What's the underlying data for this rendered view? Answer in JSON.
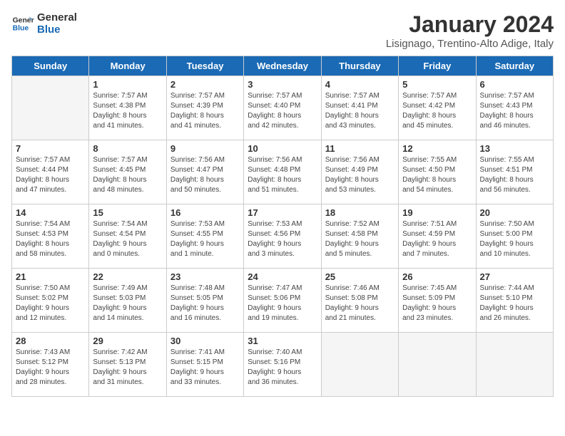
{
  "header": {
    "logo_line1": "General",
    "logo_line2": "Blue",
    "month": "January 2024",
    "location": "Lisignago, Trentino-Alto Adige, Italy"
  },
  "days_of_week": [
    "Sunday",
    "Monday",
    "Tuesday",
    "Wednesday",
    "Thursday",
    "Friday",
    "Saturday"
  ],
  "weeks": [
    [
      {
        "day": "",
        "content": ""
      },
      {
        "day": "1",
        "content": "Sunrise: 7:57 AM\nSunset: 4:38 PM\nDaylight: 8 hours\nand 41 minutes."
      },
      {
        "day": "2",
        "content": "Sunrise: 7:57 AM\nSunset: 4:39 PM\nDaylight: 8 hours\nand 41 minutes."
      },
      {
        "day": "3",
        "content": "Sunrise: 7:57 AM\nSunset: 4:40 PM\nDaylight: 8 hours\nand 42 minutes."
      },
      {
        "day": "4",
        "content": "Sunrise: 7:57 AM\nSunset: 4:41 PM\nDaylight: 8 hours\nand 43 minutes."
      },
      {
        "day": "5",
        "content": "Sunrise: 7:57 AM\nSunset: 4:42 PM\nDaylight: 8 hours\nand 45 minutes."
      },
      {
        "day": "6",
        "content": "Sunrise: 7:57 AM\nSunset: 4:43 PM\nDaylight: 8 hours\nand 46 minutes."
      }
    ],
    [
      {
        "day": "7",
        "content": "Sunrise: 7:57 AM\nSunset: 4:44 PM\nDaylight: 8 hours\nand 47 minutes."
      },
      {
        "day": "8",
        "content": "Sunrise: 7:57 AM\nSunset: 4:45 PM\nDaylight: 8 hours\nand 48 minutes."
      },
      {
        "day": "9",
        "content": "Sunrise: 7:56 AM\nSunset: 4:47 PM\nDaylight: 8 hours\nand 50 minutes."
      },
      {
        "day": "10",
        "content": "Sunrise: 7:56 AM\nSunset: 4:48 PM\nDaylight: 8 hours\nand 51 minutes."
      },
      {
        "day": "11",
        "content": "Sunrise: 7:56 AM\nSunset: 4:49 PM\nDaylight: 8 hours\nand 53 minutes."
      },
      {
        "day": "12",
        "content": "Sunrise: 7:55 AM\nSunset: 4:50 PM\nDaylight: 8 hours\nand 54 minutes."
      },
      {
        "day": "13",
        "content": "Sunrise: 7:55 AM\nSunset: 4:51 PM\nDaylight: 8 hours\nand 56 minutes."
      }
    ],
    [
      {
        "day": "14",
        "content": "Sunrise: 7:54 AM\nSunset: 4:53 PM\nDaylight: 8 hours\nand 58 minutes."
      },
      {
        "day": "15",
        "content": "Sunrise: 7:54 AM\nSunset: 4:54 PM\nDaylight: 9 hours\nand 0 minutes."
      },
      {
        "day": "16",
        "content": "Sunrise: 7:53 AM\nSunset: 4:55 PM\nDaylight: 9 hours\nand 1 minute."
      },
      {
        "day": "17",
        "content": "Sunrise: 7:53 AM\nSunset: 4:56 PM\nDaylight: 9 hours\nand 3 minutes."
      },
      {
        "day": "18",
        "content": "Sunrise: 7:52 AM\nSunset: 4:58 PM\nDaylight: 9 hours\nand 5 minutes."
      },
      {
        "day": "19",
        "content": "Sunrise: 7:51 AM\nSunset: 4:59 PM\nDaylight: 9 hours\nand 7 minutes."
      },
      {
        "day": "20",
        "content": "Sunrise: 7:50 AM\nSunset: 5:00 PM\nDaylight: 9 hours\nand 10 minutes."
      }
    ],
    [
      {
        "day": "21",
        "content": "Sunrise: 7:50 AM\nSunset: 5:02 PM\nDaylight: 9 hours\nand 12 minutes."
      },
      {
        "day": "22",
        "content": "Sunrise: 7:49 AM\nSunset: 5:03 PM\nDaylight: 9 hours\nand 14 minutes."
      },
      {
        "day": "23",
        "content": "Sunrise: 7:48 AM\nSunset: 5:05 PM\nDaylight: 9 hours\nand 16 minutes."
      },
      {
        "day": "24",
        "content": "Sunrise: 7:47 AM\nSunset: 5:06 PM\nDaylight: 9 hours\nand 19 minutes."
      },
      {
        "day": "25",
        "content": "Sunrise: 7:46 AM\nSunset: 5:08 PM\nDaylight: 9 hours\nand 21 minutes."
      },
      {
        "day": "26",
        "content": "Sunrise: 7:45 AM\nSunset: 5:09 PM\nDaylight: 9 hours\nand 23 minutes."
      },
      {
        "day": "27",
        "content": "Sunrise: 7:44 AM\nSunset: 5:10 PM\nDaylight: 9 hours\nand 26 minutes."
      }
    ],
    [
      {
        "day": "28",
        "content": "Sunrise: 7:43 AM\nSunset: 5:12 PM\nDaylight: 9 hours\nand 28 minutes."
      },
      {
        "day": "29",
        "content": "Sunrise: 7:42 AM\nSunset: 5:13 PM\nDaylight: 9 hours\nand 31 minutes."
      },
      {
        "day": "30",
        "content": "Sunrise: 7:41 AM\nSunset: 5:15 PM\nDaylight: 9 hours\nand 33 minutes."
      },
      {
        "day": "31",
        "content": "Sunrise: 7:40 AM\nSunset: 5:16 PM\nDaylight: 9 hours\nand 36 minutes."
      },
      {
        "day": "",
        "content": ""
      },
      {
        "day": "",
        "content": ""
      },
      {
        "day": "",
        "content": ""
      }
    ]
  ]
}
